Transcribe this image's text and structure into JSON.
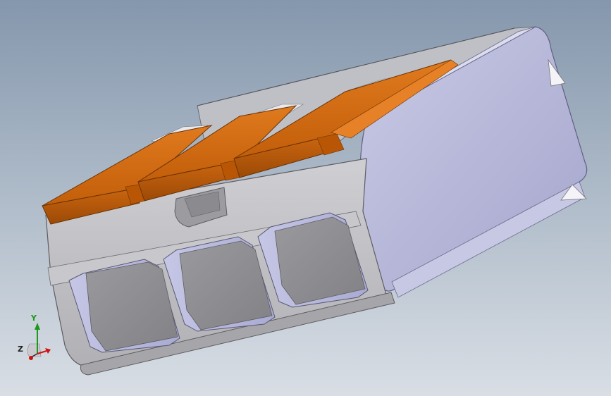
{
  "viewport": {
    "background_top": "#8597ad",
    "background_bottom": "#d9dee5"
  },
  "model": {
    "body_color": "#b3b4d6",
    "body_shadow": "#9a9bc4",
    "body_highlight": "#d8d9ee",
    "front_color": "#c4c4c8",
    "front_dark": "#8e8e92",
    "lever_color": "#d56a0e",
    "lever_dark": "#9a4805",
    "lever_light": "#ec8a32"
  },
  "triad": {
    "y_label": "Y",
    "z_label": "Z",
    "y_color": "#1a9a1a",
    "x_color": "#d01010",
    "z_color": "#2a2a2a"
  }
}
